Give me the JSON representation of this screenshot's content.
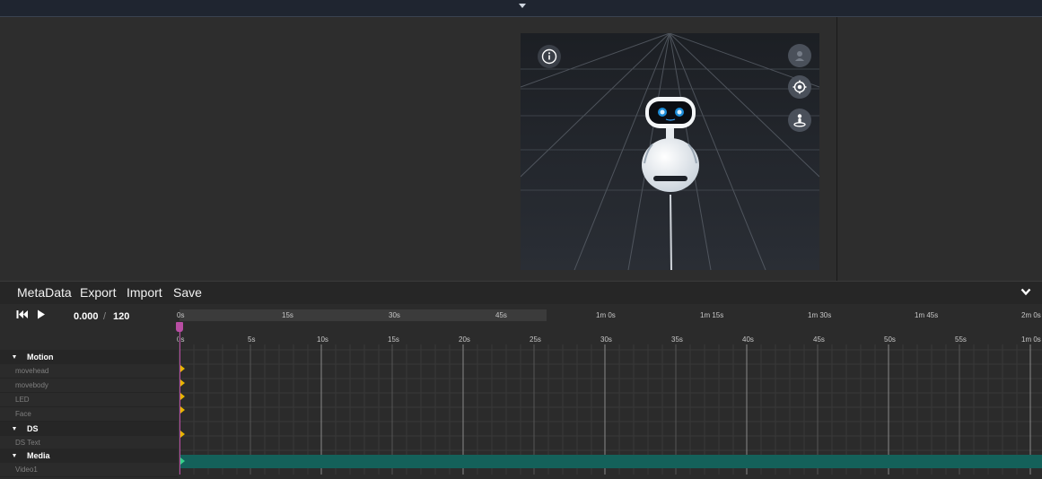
{
  "menu": {
    "items": [
      "MetaData",
      "Export",
      "Import",
      "Save"
    ]
  },
  "transport": {
    "current_time": "0.000",
    "separator": "/",
    "total_time": "120"
  },
  "ruler_top": [
    "0s",
    "15s",
    "30s",
    "45s",
    "1m 0s",
    "1m 15s",
    "1m 30s",
    "1m 45s",
    "2m 0s"
  ],
  "ruler_mid": [
    "0s",
    "5s",
    "10s",
    "15s",
    "20s",
    "25s",
    "30s",
    "35s",
    "40s",
    "45s",
    "50s",
    "55s",
    "1m 0s"
  ],
  "tracks": {
    "motion_group": "Motion",
    "movehead": "movehead",
    "movebody": "movebody",
    "led": "LED",
    "face": "Face",
    "ds_group": "DS",
    "ds_text": "DS Text",
    "media_group": "Media",
    "video1": "Video1"
  },
  "colors": {
    "accent_playhead": "#b84da3",
    "keyframe_motion": "#e8b400",
    "media_clip": "#14615a",
    "keyframe_media": "#36d18a"
  },
  "icons": {
    "info": "info-icon",
    "user": "user-icon",
    "target": "target-icon",
    "reset_position": "person-on-base-icon",
    "skip_back": "skip-to-start-icon",
    "play": "play-icon",
    "collapse": "chevron-down-icon"
  }
}
